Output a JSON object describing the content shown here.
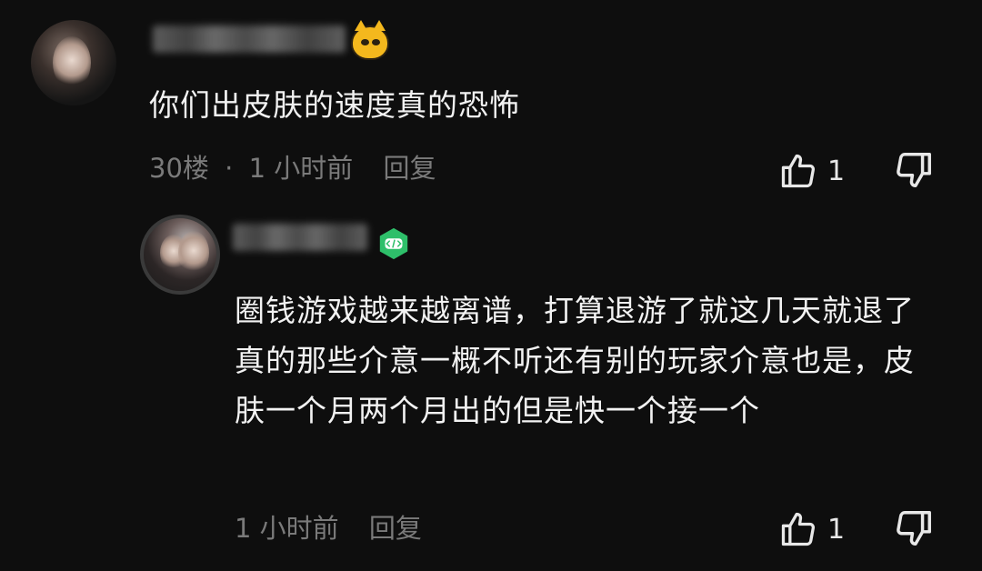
{
  "comment": {
    "text": "你们出皮肤的速度真的恐怖",
    "floor": "30楼",
    "dot": "·",
    "time": "1 小时前",
    "reply_label": "回复",
    "like_count": "1"
  },
  "reply": {
    "text": "圈钱游戏越来越离谱，打算退游了就这几天就退了真的那些介意一概不听还有别的玩家介意也是，皮肤一个月两个月出的但是快一个接一个",
    "time": "1 小时前",
    "reply_label": "回复",
    "like_count": "1"
  },
  "icons": {
    "like": "thumbs-up-icon",
    "dislike": "thumbs-down-icon",
    "cat_badge": "cat-badge-icon",
    "game_badge": "game-controller-badge-icon"
  },
  "colors": {
    "background": "#0e0e0e",
    "text": "#f2f2f2",
    "meta": "#7a7a7a",
    "game_badge": "#2ebf6a",
    "cat_badge": "#f4b81d"
  }
}
